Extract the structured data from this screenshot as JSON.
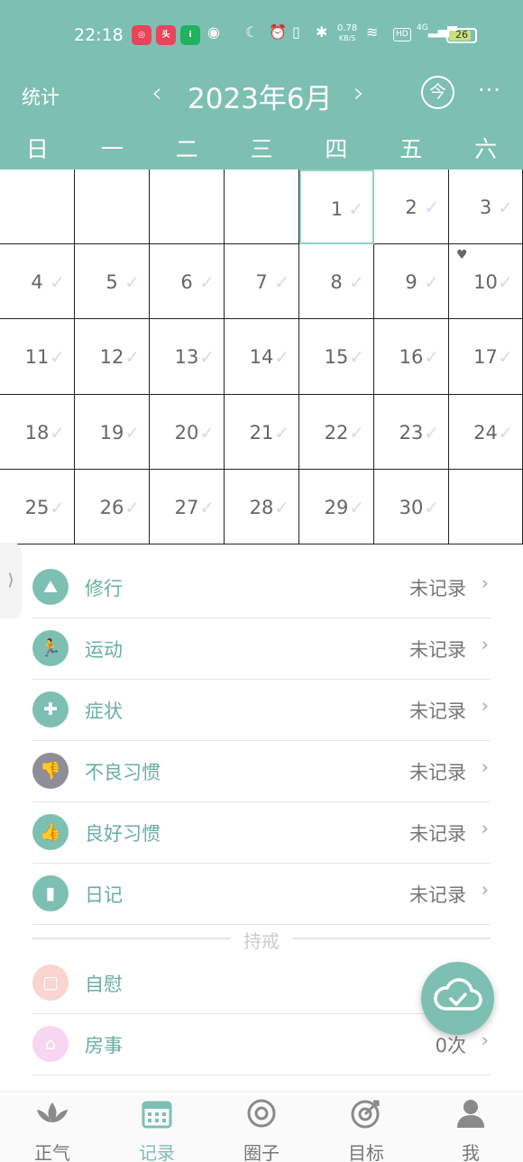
{
  "status_bar": {
    "time": "22:18",
    "net_speed_top": "0.78",
    "net_speed_unit": "KB/S",
    "signal": "4G",
    "hd": "HD",
    "battery": "26"
  },
  "header": {
    "stats_label": "统计",
    "month_title": "2023年6月",
    "today_label": "今",
    "more_label": "···",
    "prev_label": "‹",
    "next_label": "›"
  },
  "weekdays": [
    "日",
    "一",
    "二",
    "三",
    "四",
    "五",
    "六"
  ],
  "calendar": {
    "year": 2023,
    "month": 6,
    "first_weekday": 4,
    "days": 30,
    "today": 1,
    "special_day": 10
  },
  "records": [
    {
      "label": "修行",
      "value": "未记录",
      "icon": "meditation-icon",
      "color": "#7dbfb3"
    },
    {
      "label": "运动",
      "value": "未记录",
      "icon": "running-icon",
      "color": "#7dbfb3"
    },
    {
      "label": "症状",
      "value": "未记录",
      "icon": "medical-kit-icon",
      "color": "#7dbfb3"
    },
    {
      "label": "不良习惯",
      "value": "未记录",
      "icon": "thumbs-down-icon",
      "color": "#8e8e99"
    },
    {
      "label": "良好习惯",
      "value": "未记录",
      "icon": "thumbs-up-icon",
      "color": "#7dbfb3"
    },
    {
      "label": "日记",
      "value": "未记录",
      "icon": "diary-icon",
      "color": "#7dbfb3"
    }
  ],
  "precepts": {
    "divider_label": "持戒",
    "items": [
      {
        "label": "自慰",
        "value": "",
        "icon": "tissue-icon",
        "color": "#f6b1a9"
      },
      {
        "label": "房事",
        "value": "0次",
        "icon": "house-icon",
        "color": "#f3b4e6"
      }
    ]
  },
  "nav": [
    {
      "label": "正气",
      "icon": "lotus-icon",
      "active": false
    },
    {
      "label": "记录",
      "icon": "calendar-icon",
      "active": true
    },
    {
      "label": "圈子",
      "icon": "circle-icon",
      "active": false
    },
    {
      "label": "目标",
      "icon": "target-icon",
      "active": false
    },
    {
      "label": "我",
      "icon": "user-icon",
      "active": false
    }
  ],
  "accent_color": "#7dbfb3"
}
